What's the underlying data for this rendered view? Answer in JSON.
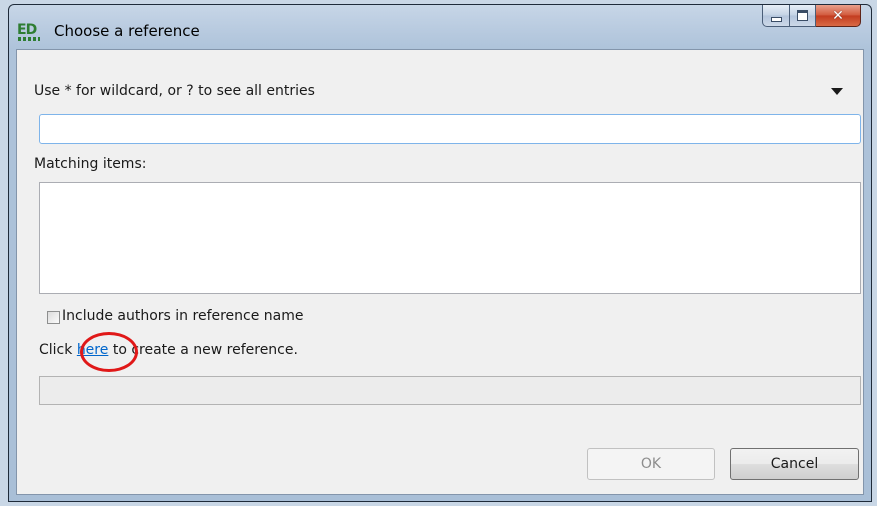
{
  "window": {
    "title": "Choose a reference",
    "app_icon": "ED",
    "controls": {
      "minimize": "minimize-icon",
      "maximize": "maximize-icon",
      "close": "✕"
    }
  },
  "search": {
    "hint": "Use * for wildcard, or ? to see all entries",
    "value": "",
    "history_icon": "dropdown-arrow-icon"
  },
  "matching": {
    "label": "Matching items:",
    "items": []
  },
  "options": {
    "include_authors_label": "Include authors in reference name",
    "include_authors_checked": false
  },
  "create": {
    "prefix": "Click ",
    "link": "here",
    "suffix": " to create a new reference."
  },
  "status": {
    "text": ""
  },
  "buttons": {
    "ok": "OK",
    "cancel": "Cancel"
  },
  "colors": {
    "link": "#0066cc",
    "highlight_circle": "#e01818",
    "close_button": "#c23b1f"
  }
}
